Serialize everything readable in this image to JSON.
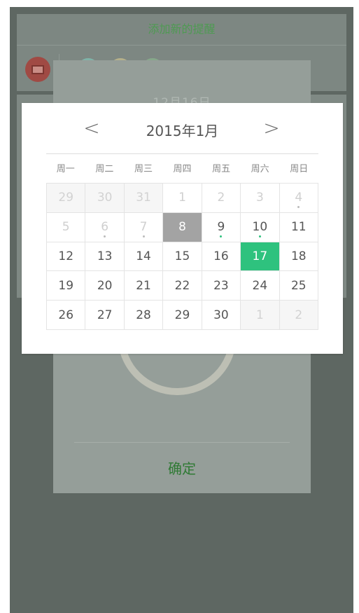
{
  "background": {
    "title": "添加新的提醒",
    "date_text": "12月16日",
    "confirm_label": "确定",
    "tag_colors": [
      "#7fb3a8",
      "#b5b08a",
      "#86a88a"
    ]
  },
  "calendar": {
    "prev_label": "<",
    "next_label": ">",
    "month_label": "2015年1月",
    "weekdays": [
      "周一",
      "周二",
      "周三",
      "周四",
      "周五",
      "周六",
      "周日"
    ],
    "cells": [
      {
        "day": "29",
        "state": "outside"
      },
      {
        "day": "30",
        "state": "outside"
      },
      {
        "day": "31",
        "state": "outside"
      },
      {
        "day": "1",
        "state": "past"
      },
      {
        "day": "2",
        "state": "past"
      },
      {
        "day": "3",
        "state": "past"
      },
      {
        "day": "4",
        "state": "past",
        "dot": "#bbbbbb"
      },
      {
        "day": "5",
        "state": "past"
      },
      {
        "day": "6",
        "state": "past",
        "dot": "#bbbbbb"
      },
      {
        "day": "7",
        "state": "past",
        "dot": "#bbbbbb"
      },
      {
        "day": "8",
        "state": "today"
      },
      {
        "day": "9",
        "state": "normal",
        "dot": "#2ec27e"
      },
      {
        "day": "10",
        "state": "normal",
        "dot": "#2ec27e"
      },
      {
        "day": "11",
        "state": "normal"
      },
      {
        "day": "12",
        "state": "normal"
      },
      {
        "day": "13",
        "state": "normal"
      },
      {
        "day": "14",
        "state": "normal"
      },
      {
        "day": "15",
        "state": "normal"
      },
      {
        "day": "16",
        "state": "normal"
      },
      {
        "day": "17",
        "state": "selected"
      },
      {
        "day": "18",
        "state": "normal"
      },
      {
        "day": "19",
        "state": "normal"
      },
      {
        "day": "20",
        "state": "normal"
      },
      {
        "day": "21",
        "state": "normal"
      },
      {
        "day": "22",
        "state": "normal"
      },
      {
        "day": "23",
        "state": "normal"
      },
      {
        "day": "24",
        "state": "normal"
      },
      {
        "day": "25",
        "state": "normal"
      },
      {
        "day": "26",
        "state": "normal"
      },
      {
        "day": "27",
        "state": "normal"
      },
      {
        "day": "28",
        "state": "normal"
      },
      {
        "day": "29",
        "state": "normal"
      },
      {
        "day": "30",
        "state": "normal"
      },
      {
        "day": "1",
        "state": "outside"
      },
      {
        "day": "2",
        "state": "outside"
      }
    ],
    "accent_color": "#2ec27e",
    "today_color": "#a3a3a3"
  }
}
